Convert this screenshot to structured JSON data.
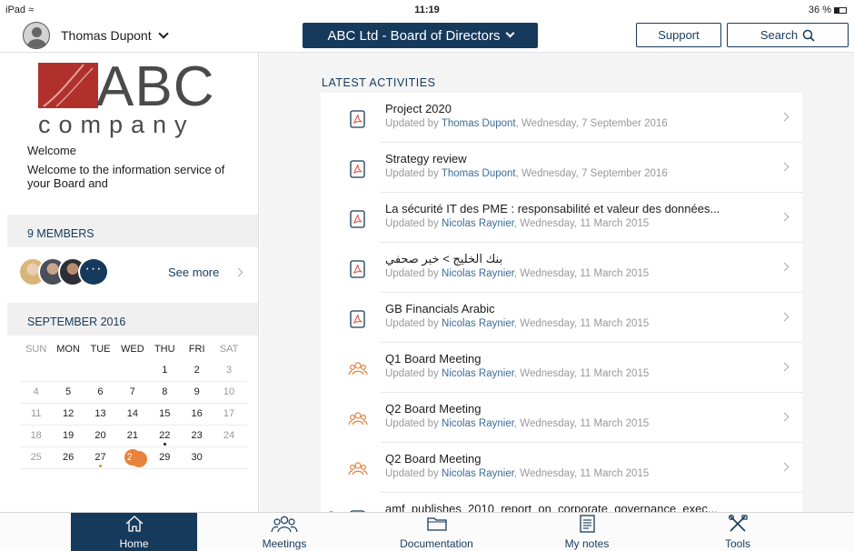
{
  "status_bar": {
    "device": "iPad",
    "time": "11:19",
    "battery": "36 %"
  },
  "header": {
    "user_name": "Thomas Dupont",
    "board_selector": "ABC Ltd - Board of Directors",
    "support_label": "Support",
    "search_label": "Search"
  },
  "sidebar": {
    "logo": {
      "abc": "ABC",
      "company": "company"
    },
    "welcome_title": "Welcome",
    "welcome_text": "Welcome to the information service of your Board and",
    "members_heading": "9 MEMBERS",
    "more_members": "···",
    "see_more": "See more",
    "calendar_heading": "SEPTEMBER 2016",
    "weekdays": [
      "SUN",
      "MON",
      "TUE",
      "WED",
      "THU",
      "FRI",
      "SAT"
    ],
    "weeks": [
      [
        "",
        "",
        "",
        "",
        "1",
        "2",
        "3"
      ],
      [
        "4",
        "5",
        "6",
        "7",
        "8",
        "9",
        "10"
      ],
      [
        "11",
        "12",
        "13",
        "14",
        "15",
        "16",
        "17"
      ],
      [
        "18",
        "19",
        "20",
        "21",
        "22",
        "23",
        "24"
      ],
      [
        "25",
        "26",
        "27",
        "28",
        "29",
        "30",
        ""
      ]
    ],
    "today": "28",
    "event_days": [
      "22",
      "28"
    ],
    "note_days": [
      "27"
    ]
  },
  "main": {
    "heading": "LATEST ACTIVITIES",
    "activities": [
      {
        "icon": "pdf-document-icon",
        "title": "Project 2020",
        "updated_by": "Updated by ",
        "who": "Thomas Dupont",
        "when": ", Wednesday, 7 September 2016"
      },
      {
        "icon": "pdf-document-icon",
        "title": "Strategy review",
        "updated_by": "Updated by ",
        "who": "Thomas Dupont",
        "when": ", Wednesday, 7 September 2016"
      },
      {
        "icon": "pdf-document-icon",
        "title": "La sécurité IT des PME : responsabilité et valeur des données...",
        "updated_by": "Updated by ",
        "who": "Nicolas Raynier",
        "when": ", Wednesday, 11 March 2015"
      },
      {
        "icon": "pdf-document-icon",
        "title": "بنك الخليج > خبر صحفي",
        "updated_by": "Updated by ",
        "who": "Nicolas Raynier",
        "when": ", Wednesday, 11 March 2015"
      },
      {
        "icon": "pdf-document-icon",
        "title": "GB Financials Arabic",
        "updated_by": "Updated by ",
        "who": "Nicolas Raynier",
        "when": ", Wednesday, 11 March 2015"
      },
      {
        "icon": "meeting-people-icon",
        "title": "Q1 Board Meeting",
        "updated_by": "Updated by ",
        "who": "Nicolas Raynier",
        "when": ", Wednesday, 11 March 2015"
      },
      {
        "icon": "meeting-people-icon",
        "title": "Q2 Board Meeting",
        "updated_by": "Updated by ",
        "who": "Nicolas Raynier",
        "when": ", Wednesday, 11 March 2015"
      },
      {
        "icon": "meeting-people-icon",
        "title": "Q2 Board Meeting",
        "updated_by": "Updated by ",
        "who": "Nicolas Raynier",
        "when": ", Wednesday, 11 March 2015"
      },
      {
        "icon": "pdf-document-icon",
        "title": "amf_publishes_2010_report_on_corporate_governance_exec...",
        "updated_by": "",
        "who": "",
        "when": ""
      }
    ]
  },
  "tabbar": {
    "tabs": [
      {
        "label": "Home",
        "icon": "home-icon",
        "active": true
      },
      {
        "label": "Meetings",
        "icon": "meetings-icon",
        "active": false
      },
      {
        "label": "Documentation",
        "icon": "folder-icon",
        "active": false
      },
      {
        "label": "My notes",
        "icon": "notes-icon",
        "active": false
      },
      {
        "label": "Tools",
        "icon": "tools-icon",
        "active": false
      }
    ]
  },
  "colors": {
    "primary": "#163a5c",
    "accent": "#e8823b",
    "logo_red": "#b0312c",
    "link": "#3d6c98"
  }
}
